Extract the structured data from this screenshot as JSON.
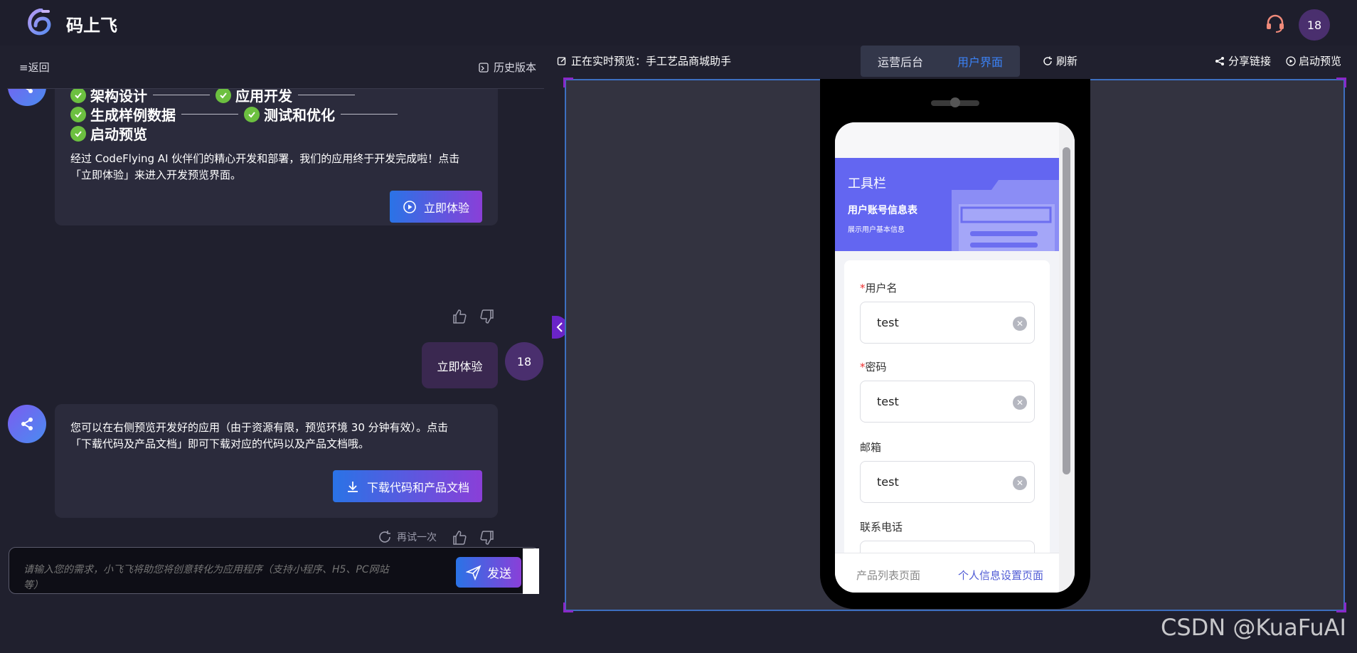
{
  "header": {
    "app_name": "码上飞",
    "avatar_text": "18"
  },
  "left": {
    "back_label": "≡返回",
    "history_label": "历史版本",
    "steps": {
      "row1_a": "架构设计",
      "row1_b": "应用开发",
      "row2_a": "生成样例数据",
      "row2_b": "测试和优化",
      "row3_a": "启动预览"
    },
    "msg1_line1": "经过 CodeFlying AI 伙伴们的精心开发和部署，我们的应用终于开发完成啦！点击",
    "msg1_line2": "「立即体验」来进入开发预览界面。",
    "try_button": "立即体验",
    "user_message": "立即体验",
    "user_avatar": "18",
    "msg2_line1": "您可以在右侧预览开发好的应用（由于资源有限，预览环境 30 分钟有效）。点击",
    "msg2_line2": "「下载代码及产品文档」即可下载对应的代码以及产品文档哦。",
    "download_button": "下载代码和产品文档",
    "retry_label": "再试一次",
    "input_placeholder": "请输入您的需求，小飞飞将助您将创意转化为应用程序（支持小程序、H5、PC网站等）",
    "send_label": "发送"
  },
  "toolbar": {
    "preview_label": "正在实时预览：手工艺品商城助手",
    "tabs": [
      "运营后台",
      "用户界面"
    ],
    "active_tab": 1,
    "refresh_label": "刷新",
    "share_label": "分享链接",
    "launch_label": "启动预览"
  },
  "phone": {
    "banner_title": "工具栏",
    "banner_sub": "用户账号信息表",
    "banner_desc": "展示用户基本信息",
    "fields": [
      {
        "label": "用户名",
        "required": true,
        "value": "test"
      },
      {
        "label": "密码",
        "required": true,
        "value": "test"
      },
      {
        "label": "邮箱",
        "required": false,
        "value": "test"
      },
      {
        "label": "联系电话",
        "required": false,
        "value": ""
      }
    ],
    "required_mark": "*",
    "tabbar": [
      "产品列表页面",
      "个人信息设置页面"
    ],
    "active_tabbar": 1
  },
  "watermark": "CSDN @KuaFuAI",
  "colors": {
    "accent_blue": "#3b82f6",
    "banner": "#6366f1",
    "check_green": "#6cc040",
    "user_bubble": "#3a2850"
  }
}
